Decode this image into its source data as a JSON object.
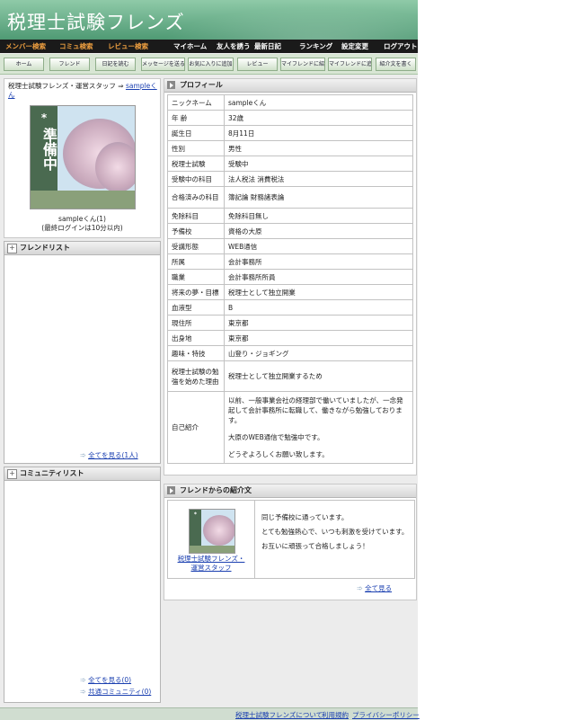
{
  "site": {
    "title": "税理士試験フレンズ"
  },
  "nav_primary": [
    "メンバー検索",
    "コミュ検索",
    "レビュー検索",
    "マイホーム",
    "友人を誘う",
    "最新日記",
    "ランキング",
    "設定変更",
    "ログアウト"
  ],
  "nav_secondary": [
    "ホーム",
    "フレンド",
    "日記を読む",
    "メッセージを送る",
    "お気に入りに追加",
    "レビュー",
    "マイフレンドに紹介",
    "マイフレンドに追加",
    "紹介文を書く"
  ],
  "owner": {
    "breadcrumb": "税理士試験フレンズ・運営スタッフ",
    "arrow": "⇒",
    "breadcrumb_link": "sampleくん",
    "photo_mark": "*",
    "photo_text": "準備中",
    "name": "sampleくん(1)",
    "last_login": "(最終ログインは10分以内)"
  },
  "friend_list": {
    "title": "フレンドリスト",
    "see_all": "全てを見る(1人)"
  },
  "community_list": {
    "title": "コミュニティリスト",
    "see_all": "全てを見る(0)",
    "common": "共通コミュニティ(0)"
  },
  "profile": {
    "title": "プロフィール",
    "rows": [
      {
        "k": "ニックネーム",
        "v": "sampleくん"
      },
      {
        "k": "年 齢",
        "v": "32歳"
      },
      {
        "k": "誕生日",
        "v": "8月11日"
      },
      {
        "k": "性別",
        "v": "男性"
      },
      {
        "k": "税理士試験",
        "v": "受験中"
      },
      {
        "k": "受験中の科目",
        "v": "法人税法 消費税法"
      },
      {
        "k": "合格済みの科目",
        "v": "簿記論 財務諸表論"
      },
      {
        "k": "免除科目",
        "v": "免除科目無し"
      },
      {
        "k": "予備校",
        "v": "資格の大原"
      },
      {
        "k": "受講形態",
        "v": "WEB通信"
      },
      {
        "k": "所属",
        "v": "会計事務所"
      },
      {
        "k": "職業",
        "v": "会計事務所所員"
      },
      {
        "k": "将来の夢・目標",
        "v": "税理士として独立開業"
      },
      {
        "k": "血液型",
        "v": "B"
      },
      {
        "k": "現住所",
        "v": "東京都"
      },
      {
        "k": "出身地",
        "v": "東京都"
      },
      {
        "k": "趣味・特技",
        "v": "山登り・ジョギング"
      },
      {
        "k": "税理士試験の勉強を始めた理由",
        "v": "税理士として独立開業するため"
      }
    ],
    "intro_key": "自己紹介",
    "intro_p1": "以前、一般事業会社の経理部で働いていましたが、一念発起して会計事務所に転職して、働きながら勉強しております。",
    "intro_p2": "大原のWEB通信で勉強中です。",
    "intro_p3": "どうぞよろしくお願い致します。"
  },
  "intro_from_friends": {
    "title": "フレンドからの紹介文",
    "author": "税理士試験フレンズ・運営スタッフ",
    "text1": "同じ予備校に通っています。",
    "text2": "とても勉強熱心で、いつも刺激を受けています。",
    "text3": "お互いに頑張って合格しましょう！",
    "see_all": "全て見る"
  },
  "footer": {
    "about": "税理士試験フレンズについて",
    "terms": "利用規約",
    "privacy": "プライバシーポリシー"
  }
}
